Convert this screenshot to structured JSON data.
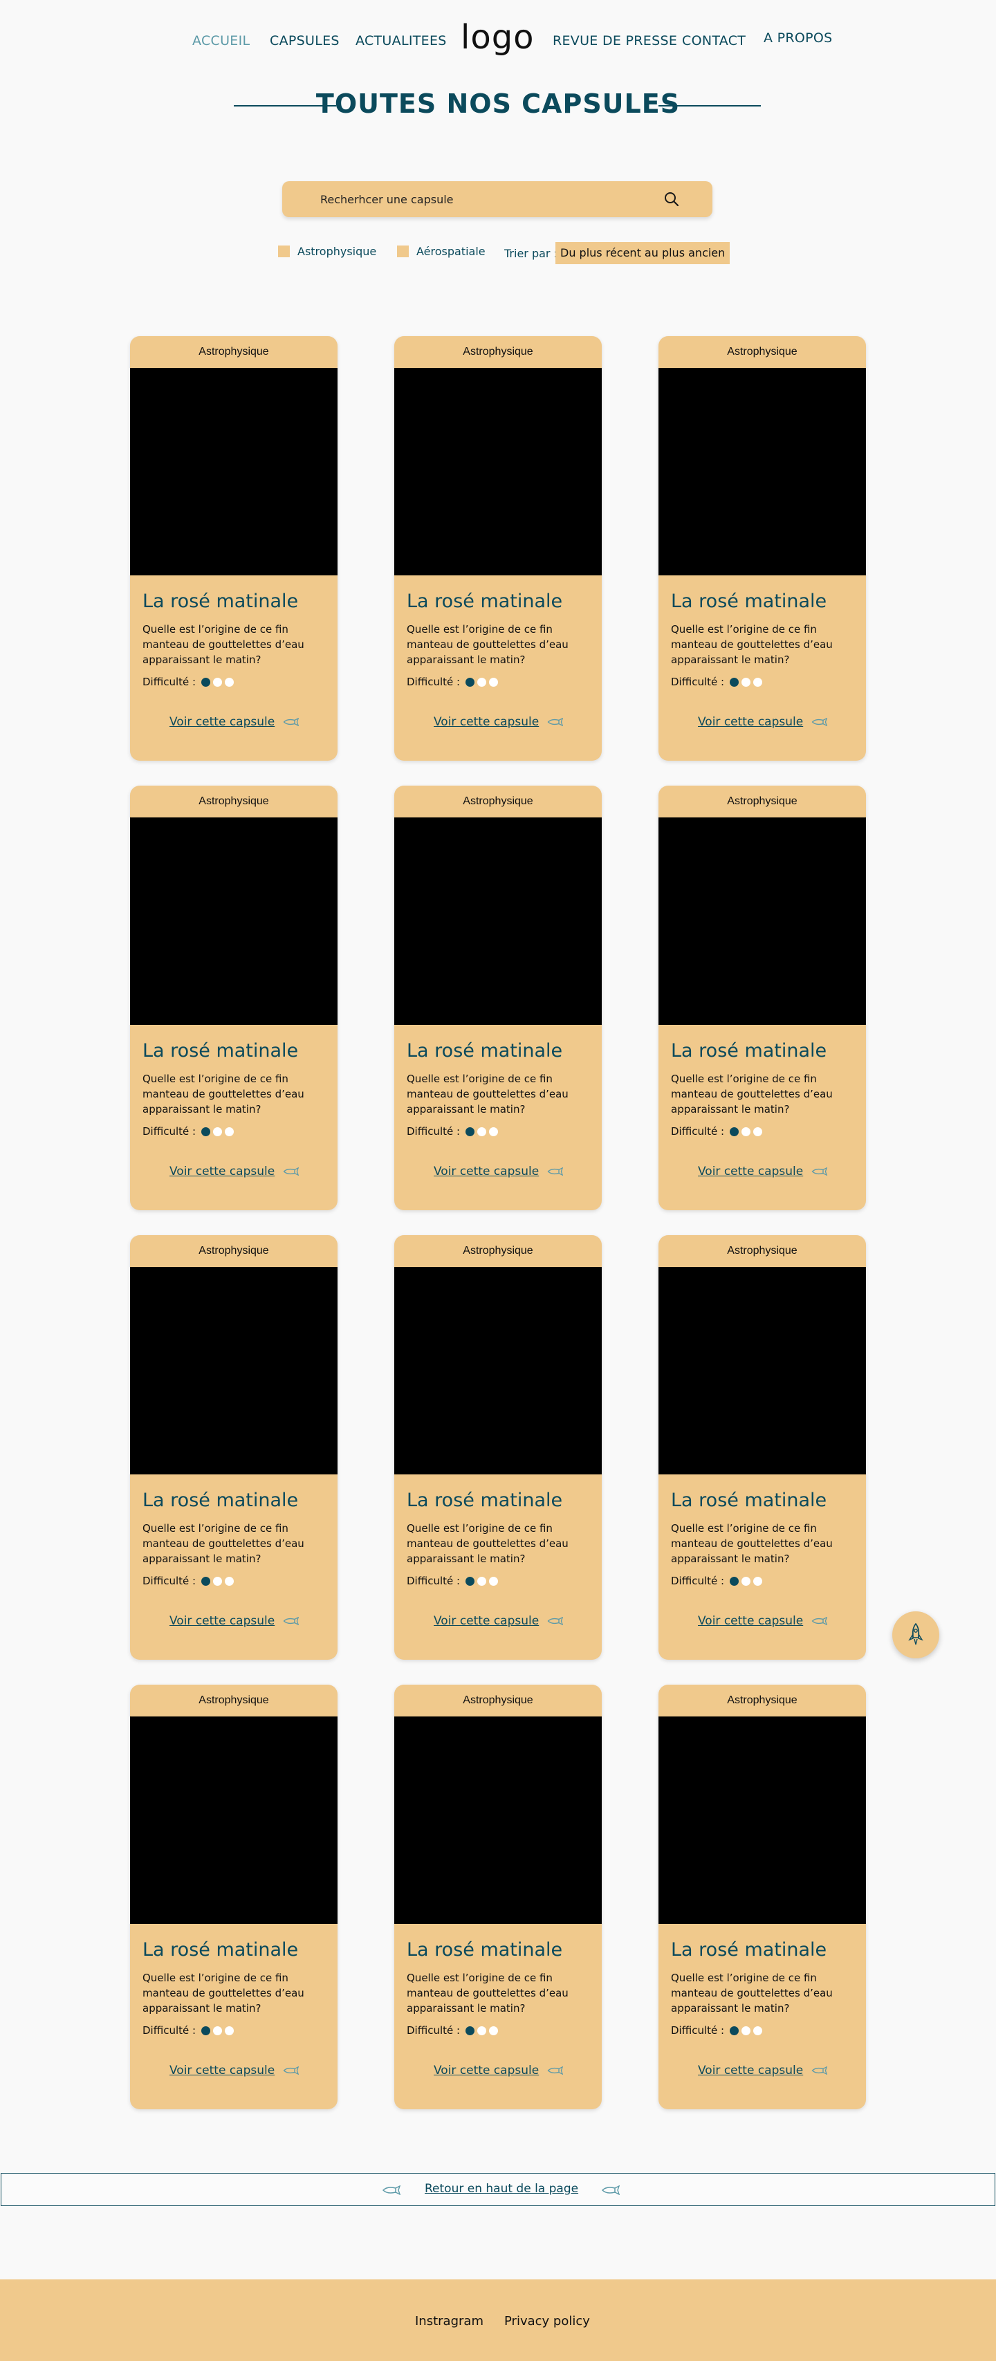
{
  "nav": {
    "items": [
      {
        "label": "ACCUEIL"
      },
      {
        "label": "CAPSULES"
      },
      {
        "label": "ACTUALITEES"
      },
      {
        "label": "REVUE DE PRESSE"
      },
      {
        "label": "CONTACT"
      },
      {
        "label": "A PROPOS"
      }
    ],
    "logo": "logo"
  },
  "page_title": "TOUTES NOS CAPSULES",
  "search": {
    "placeholder": "Recherhcer une capsule",
    "icon": "search-icon"
  },
  "filters": {
    "categories": [
      {
        "label": "Astrophysique"
      },
      {
        "label": "Aérospatiale"
      }
    ],
    "sort_label": "Trier par :",
    "sort_value": "Du plus récent au plus ancien"
  },
  "cards": [
    {
      "category": "Astrophysique",
      "title": "La rosé matinale",
      "description": "Quelle est l’origine de ce fin manteau de gouttelettes d’eau apparaissant le matin?",
      "difficulty_label": "Difficulté :",
      "difficulty": 1,
      "link": "Voir cette capsule"
    },
    {
      "category": "Astrophysique",
      "title": "La rosé matinale",
      "description": "Quelle est l’origine de ce fin manteau de gouttelettes d’eau apparaissant le matin?",
      "difficulty_label": "Difficulté :",
      "difficulty": 1,
      "link": "Voir cette capsule"
    },
    {
      "category": "Astrophysique",
      "title": "La rosé matinale",
      "description": "Quelle est l’origine de ce fin manteau de gouttelettes d’eau apparaissant le matin?",
      "difficulty_label": "Difficulté :",
      "difficulty": 1,
      "link": "Voir cette capsule"
    },
    {
      "category": "Astrophysique",
      "title": "La rosé matinale",
      "description": "Quelle est l’origine de ce fin manteau de gouttelettes d’eau apparaissant le matin?",
      "difficulty_label": "Difficulté :",
      "difficulty": 1,
      "link": "Voir cette capsule"
    },
    {
      "category": "Astrophysique",
      "title": "La rosé matinale",
      "description": "Quelle est l’origine de ce fin manteau de gouttelettes d’eau apparaissant le matin?",
      "difficulty_label": "Difficulté :",
      "difficulty": 1,
      "link": "Voir cette capsule"
    },
    {
      "category": "Astrophysique",
      "title": "La rosé matinale",
      "description": "Quelle est l’origine de ce fin manteau de gouttelettes d’eau apparaissant le matin?",
      "difficulty_label": "Difficulté :",
      "difficulty": 1,
      "link": "Voir cette capsule"
    },
    {
      "category": "Astrophysique",
      "title": "La rosé matinale",
      "description": "Quelle est l’origine de ce fin manteau de gouttelettes d’eau apparaissant le matin?",
      "difficulty_label": "Difficulté :",
      "difficulty": 1,
      "link": "Voir cette capsule"
    },
    {
      "category": "Astrophysique",
      "title": "La rosé matinale",
      "description": "Quelle est l’origine de ce fin manteau de gouttelettes d’eau apparaissant le matin?",
      "difficulty_label": "Difficulté :",
      "difficulty": 1,
      "link": "Voir cette capsule"
    },
    {
      "category": "Astrophysique",
      "title": "La rosé matinale",
      "description": "Quelle est l’origine de ce fin manteau de gouttelettes d’eau apparaissant le matin?",
      "difficulty_label": "Difficulté :",
      "difficulty": 1,
      "link": "Voir cette capsule"
    },
    {
      "category": "Astrophysique",
      "title": "La rosé matinale",
      "description": "Quelle est l’origine de ce fin manteau de gouttelettes d’eau apparaissant le matin?",
      "difficulty_label": "Difficulté :",
      "difficulty": 1,
      "link": "Voir cette capsule"
    },
    {
      "category": "Astrophysique",
      "title": "La rosé matinale",
      "description": "Quelle est l’origine de ce fin manteau de gouttelettes d’eau apparaissant le matin?",
      "difficulty_label": "Difficulté :",
      "difficulty": 1,
      "link": "Voir cette capsule"
    },
    {
      "category": "Astrophysique",
      "title": "La rosé matinale",
      "description": "Quelle est l’origine de ce fin manteau de gouttelettes d’eau apparaissant le matin?",
      "difficulty_label": "Difficulté :",
      "difficulty": 1,
      "link": "Voir cette capsule"
    }
  ],
  "fab": {
    "icon": "rocket-icon"
  },
  "back_to_top": {
    "label": "Retour en haut de la page",
    "icon": "rocket-icon"
  },
  "footer": {
    "links": [
      {
        "label": "Instragram"
      },
      {
        "label": "Privacy policy"
      }
    ]
  },
  "colors": {
    "accent": "#f0c98c",
    "primary": "#0b4a5c",
    "background": "#f9f9f9"
  }
}
